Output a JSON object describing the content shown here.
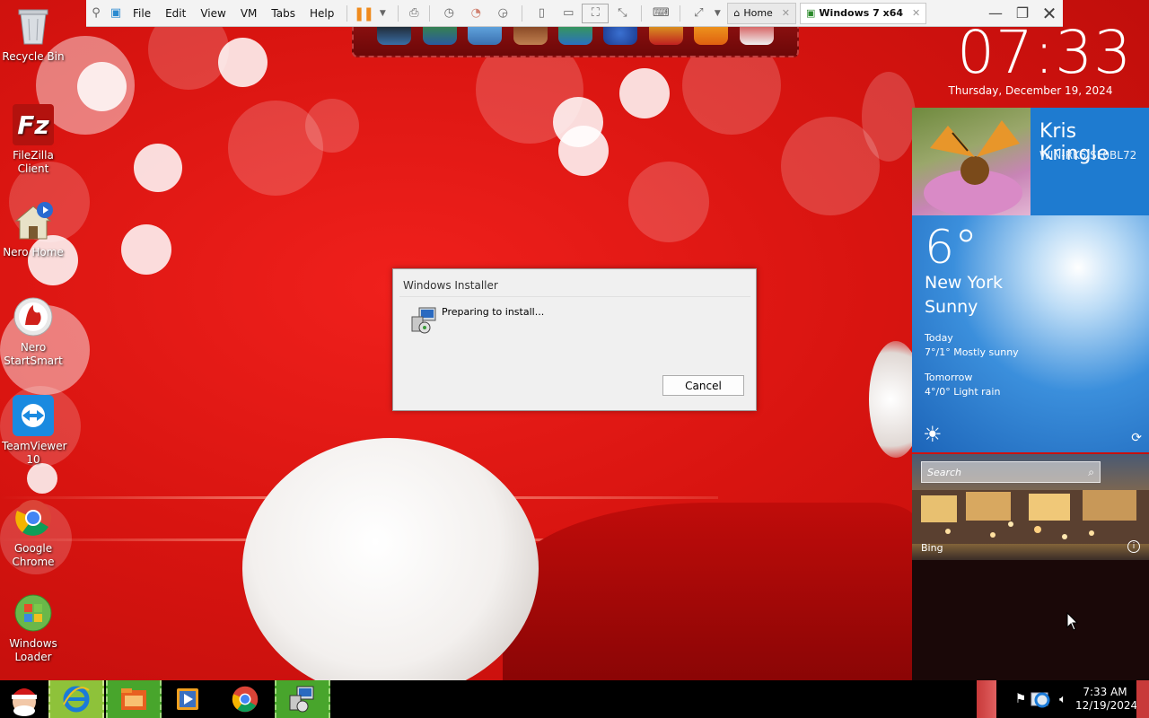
{
  "vmware": {
    "menu": [
      "File",
      "Edit",
      "View",
      "VM",
      "Tabs",
      "Help"
    ],
    "tabs": [
      {
        "label": "Home",
        "active": false
      },
      {
        "label": "Windows 7 x64",
        "active": true
      }
    ]
  },
  "desktop_icons": [
    {
      "label": "Recycle Bin",
      "icon": "recycle-bin-icon"
    },
    {
      "label": "FileZilla Client",
      "icon": "filezilla-icon"
    },
    {
      "label": "Nero Home",
      "icon": "nero-home-icon"
    },
    {
      "label": "Nero StartSmart",
      "icon": "nero-startsmart-icon"
    },
    {
      "label": "TeamViewer 10",
      "icon": "teamviewer-icon"
    },
    {
      "label": "Google Chrome",
      "icon": "chrome-icon"
    },
    {
      "label": "Windows Loader",
      "icon": "windows-loader-icon"
    }
  ],
  "dialog": {
    "title": "Windows Installer",
    "message": "Preparing to install...",
    "cancel_label": "Cancel"
  },
  "clock": {
    "time": "07:33",
    "date": "Thursday, December 19, 2024"
  },
  "user": {
    "name": "Kris Kringle",
    "machine": "WIN-RK5JSL0BL72"
  },
  "weather": {
    "temp": "6°",
    "city": "New York",
    "condition": "Sunny",
    "today_label": "Today",
    "today_forecast": "7°/1° Mostly sunny",
    "tomorrow_label": "Tomorrow",
    "tomorrow_forecast": "4°/0° Light rain"
  },
  "bing": {
    "search_placeholder": "Search",
    "label": "Bing"
  },
  "taskbar": {
    "time": "7:33 AM",
    "date": "12/19/2024"
  },
  "colors": {
    "accent_orange": "#f08a1c",
    "tile_blue": "#1e7bd0",
    "taskbar_green": "#8ec23a"
  }
}
